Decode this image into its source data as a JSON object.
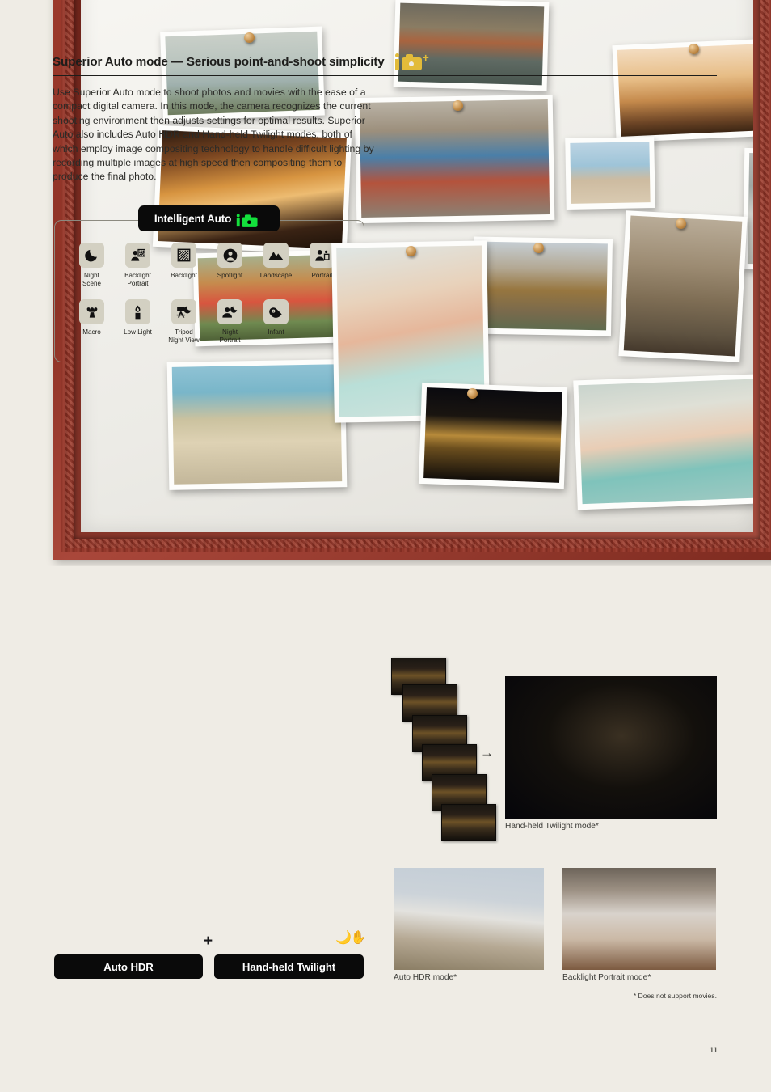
{
  "page": {
    "number": "11",
    "background_color": "#efece5"
  },
  "hero": {
    "type": "photo-collage-in-frame",
    "frame_color": "#8e3226",
    "mat_color": "#f2f1ec",
    "photos": [
      {
        "name": "riverside-temple-view",
        "scene": "river"
      },
      {
        "name": "longtail-boats",
        "scene": "boats"
      },
      {
        "name": "sunset-silhouette-trees",
        "scene": "sunset"
      },
      {
        "name": "wat-arun-sunset",
        "scene": "temple"
      },
      {
        "name": "tuk-tuk-street-market",
        "scene": "street"
      },
      {
        "name": "horse-rider-on-beach",
        "scene": "horse"
      },
      {
        "name": "beach-umbrella-bw",
        "scene": "beachumbrella"
      },
      {
        "name": "floating-market-fruits",
        "scene": "market"
      },
      {
        "name": "two-women-portrait",
        "scene": "girls"
      },
      {
        "name": "city-rooftops-temple",
        "scene": "city"
      },
      {
        "name": "carved-temple-detail",
        "scene": "carving"
      },
      {
        "name": "tropical-beach-crowd",
        "scene": "beach"
      },
      {
        "name": "wat-arun-night",
        "scene": "night"
      },
      {
        "name": "group-selfie-three-people",
        "scene": "selfie"
      }
    ]
  },
  "heading": {
    "title": "Superior Auto mode — Serious point-and-shoot simplicity",
    "icon": "intelligent-auto-plus-icon",
    "icon_color": "#e2bb3a"
  },
  "body": {
    "paragraph": "Use Superior Auto mode to shoot photos and movies with the ease of a compact digital camera. In this mode, the camera recognizes the current shooting environment then adjusts settings for optimal results. Superior Auto also includes Auto HDR and Hand-held Twilight modes, both of which employ image compositing technology to handle difficult lighting by recording multiple images at high speed then compositing them to produce the final photo."
  },
  "intelligent_auto": {
    "badge_label": "Intelligent Auto",
    "badge_icon": "intelligent-auto-icon",
    "badge_icon_color": "#13e03c",
    "tile_color": "#d3d0c2",
    "scenes_row1": [
      {
        "label": "Night\nScene",
        "icon": "moon-icon"
      },
      {
        "label": "Backlight\nPortrait",
        "icon": "backlight-portrait-icon"
      },
      {
        "label": "Backlight",
        "icon": "backlight-icon"
      },
      {
        "label": "Spotlight",
        "icon": "spotlight-icon"
      },
      {
        "label": "Landscape",
        "icon": "mountains-icon"
      },
      {
        "label": "Portrait",
        "icon": "portrait-icon"
      }
    ],
    "scenes_row2": [
      {
        "label": "Macro",
        "icon": "flower-icon"
      },
      {
        "label": "Low Light",
        "icon": "candle-icon"
      },
      {
        "label": "Tripod\nNight View",
        "icon": "tripod-moon-icon"
      },
      {
        "label": "Night\nPortrait",
        "icon": "person-moon-icon"
      },
      {
        "label": "Infant",
        "icon": "infant-icon"
      }
    ]
  },
  "modes": {
    "plus_symbol": "+",
    "moon_hand_icon": "moon-hand-icon",
    "auto_hdr_label": "Auto HDR",
    "hand_held_twilight_label": "Hand-held Twilight"
  },
  "samples": {
    "burst_frames": 6,
    "arrow": "→",
    "twilight_caption": "Hand-held Twilight mode*",
    "hdr_caption": "Auto HDR mode*",
    "backlight_portrait_caption": "Backlight Portrait mode*",
    "footnote": "* Does not support movies."
  }
}
